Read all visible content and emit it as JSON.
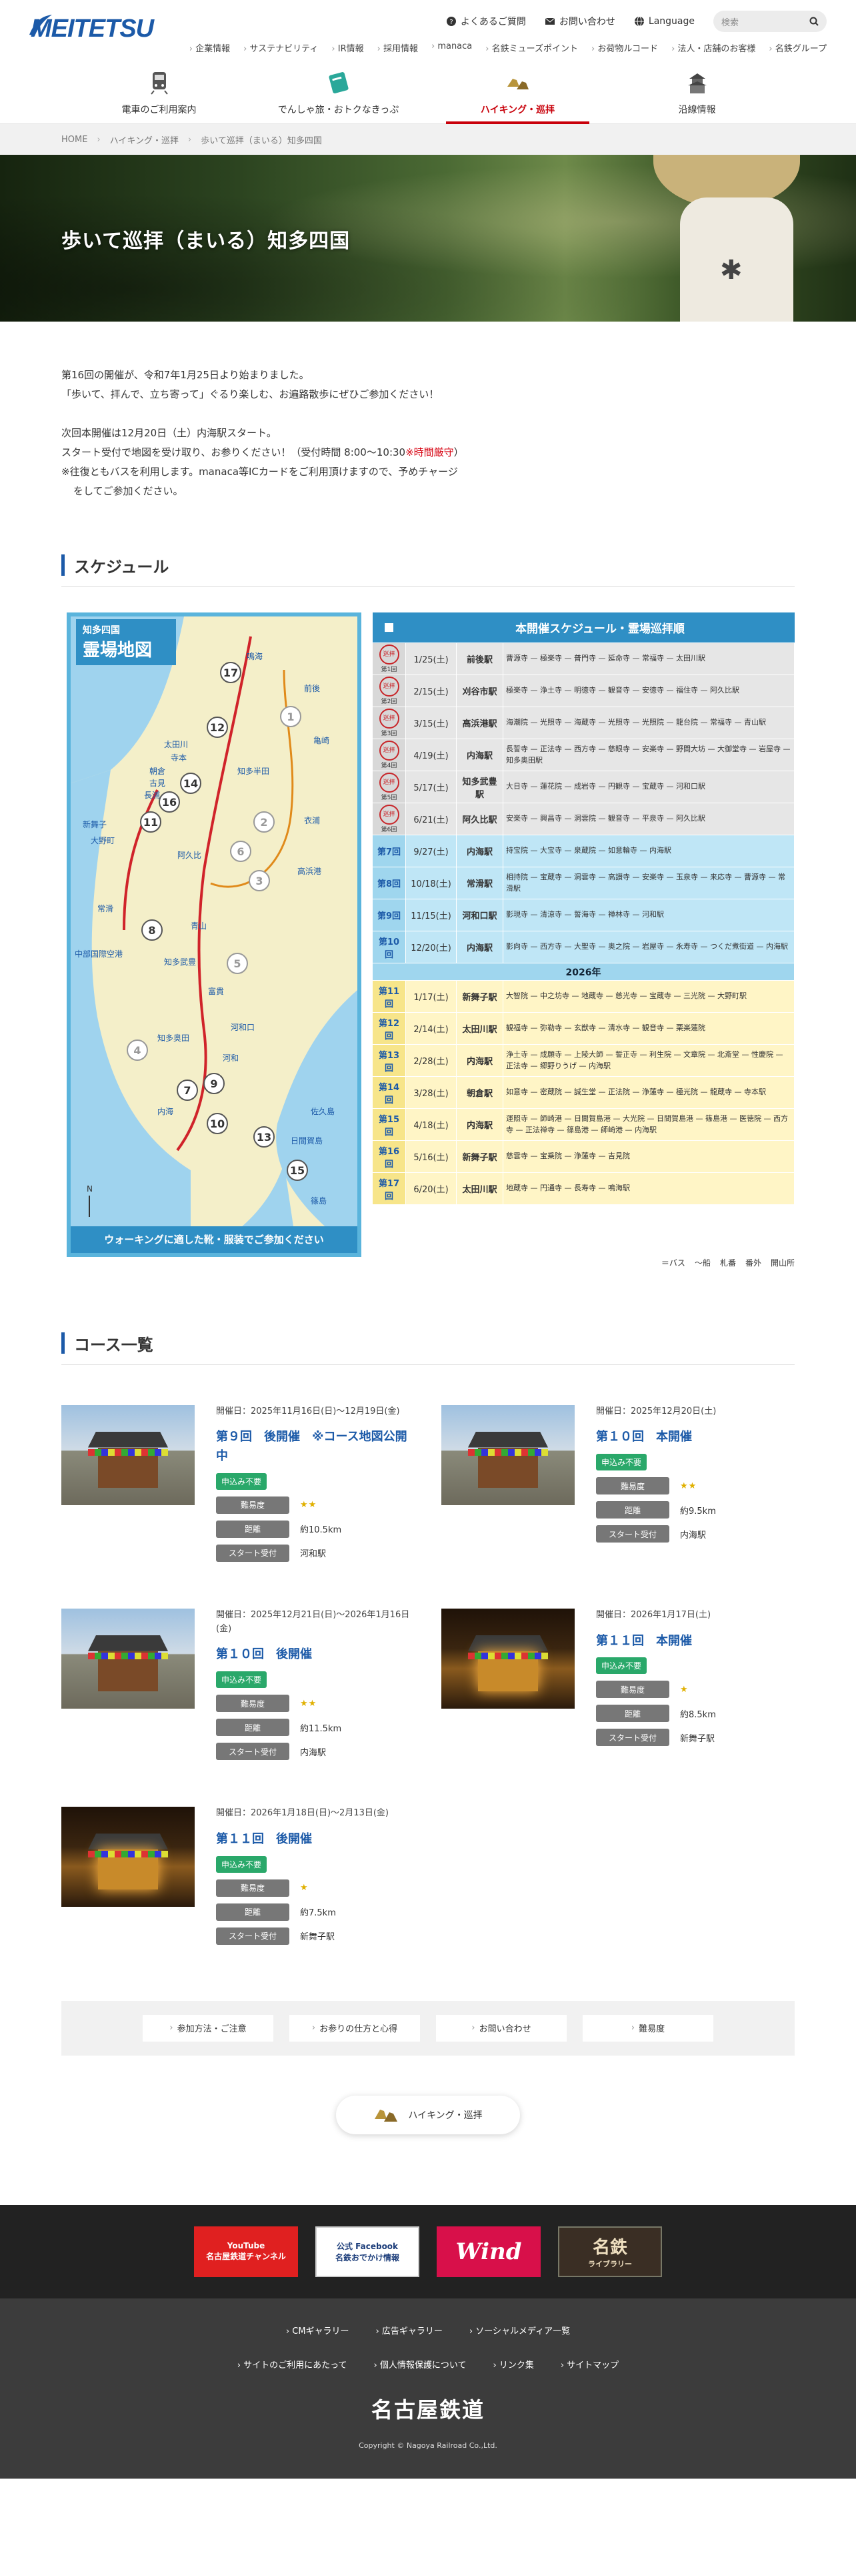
{
  "header": {
    "logo": "MEITETSU",
    "util": [
      {
        "icon": "help-circle-icon",
        "label": "よくあるご質問"
      },
      {
        "icon": "mail-icon",
        "label": "お問い合わせ"
      },
      {
        "icon": "globe-icon",
        "label": "Language"
      }
    ],
    "search_placeholder": "検索",
    "sub_links": [
      "企業情報",
      "サステナビリティ",
      "IR情報",
      "採用情報",
      "manaca",
      "名鉄ミューズポイント",
      "お荷物ルコード",
      "法人・店舗のお客様",
      "名鉄グループ"
    ],
    "nav": [
      {
        "icon": "train-icon",
        "label": "電車のご利用案内"
      },
      {
        "icon": "ticket-icon",
        "label": "でんしゃ旅・おトクなきっぷ"
      },
      {
        "icon": "hiking-shoes-icon",
        "label": "ハイキング・巡拝"
      },
      {
        "icon": "castle-icon",
        "label": "沿線情報"
      }
    ]
  },
  "breadcrumb": [
    "HOME",
    "ハイキング・巡拝",
    "歩いて巡拝（まいる）知多四国"
  ],
  "hero": {
    "title": "歩いて巡拝（まいる）知多四国"
  },
  "intro": {
    "p1": "第16回の開催が、令和7年1月25日より始まりました。",
    "p2": "「歩いて、拝んで、立ち寄って」ぐるり楽しむ、お遍路散歩にぜひご参加ください！",
    "p3": "次回本開催は12月20日（土）内海駅スタート。",
    "p4a": "スタート受付で地図を受け取り、お参りください！（受付時間 8:00～10:30",
    "p4b": "※時間厳守",
    "p4c": "）",
    "p5": "※往復ともバスを利用します。manaca等ICカードをご利用頂けますので、予めチャージ",
    "p6": "をしてご参加ください。"
  },
  "schedule_heading": "スケジュール",
  "map": {
    "title_small": "知多四国",
    "title_large": "霊場地図",
    "note": "ウォーキングに適した靴・服装でご参加ください",
    "stations": [
      "太田川",
      "寺本",
      "朝倉",
      "古見",
      "長浦",
      "新舞子",
      "大野町",
      "常滑",
      "河和口",
      "河和",
      "知多半田",
      "知多武豊",
      "阿久比",
      "青山",
      "内海",
      "富貴",
      "知多奥田",
      "高浜港",
      "衣浦",
      "日間賀島",
      "篠島",
      "佐久島",
      "亀崎",
      "前後",
      "鳴海",
      "中部国際空港"
    ]
  },
  "table": {
    "head_col1": "■",
    "head_col2": "本開催スケジュール・霊場巡拝順",
    "rows": [
      {
        "idx": "第1回",
        "date": "1/25(土)",
        "station": "前後駅",
        "route": "曹源寺 — 極楽寺 — 普門寺 — 延命寺 — 常福寺 — 太田川駅",
        "type": "base"
      },
      {
        "idx": "第2回",
        "date": "2/15(土)",
        "station": "刈谷市駅",
        "route": "極楽寺 — 浄土寺 — 明徳寺 — 観音寺 — 安徳寺 — 福住寺 — 阿久比駅",
        "type": "base"
      },
      {
        "idx": "第3回",
        "date": "3/15(土)",
        "station": "高浜港駅",
        "route": "海潮院 — 光照寺 — 海蔵寺 — 光照寺 — 光照院 — 龍台院 — 常福寺 — 青山駅",
        "type": "base"
      },
      {
        "idx": "第4回",
        "date": "4/19(土)",
        "station": "内海駅",
        "route": "長誓寺 — 正法寺 — 西方寺 — 慈眼寺 — 安楽寺 — 野間大坊 — 大御堂寺 — 岩屋寺 — 知多奥田駅",
        "type": "base"
      },
      {
        "idx": "第5回",
        "date": "5/17(土)",
        "station": "知多武豊駅",
        "route": "大日寺 — 蓮花院 — 成岩寺 — 円観寺 — 宝蔵寺 — 河和口駅",
        "type": "base"
      },
      {
        "idx": "第6回",
        "date": "6/21(土)",
        "station": "阿久比駅",
        "route": "安楽寺 — 興昌寺 — 洞雲院 — 観音寺 — 平泉寺 — 阿久比駅",
        "type": "base"
      },
      {
        "idx": "第7回",
        "date": "9/27(土)",
        "station": "内海駅",
        "route": "持宝院 — 大宝寺 — 泉蔵院 — 如意輪寺 — 内海駅",
        "type": "special"
      },
      {
        "idx": "第8回",
        "date": "10/18(土)",
        "station": "常滑駅",
        "route": "相持院 — 宝蔵寺 — 洞雲寺 — 高讃寺 — 安楽寺 — 玉泉寺 — 来応寺 — 曹源寺 — 常滑駅",
        "type": "special"
      },
      {
        "idx": "第9回",
        "date": "11/15(土)",
        "station": "河和口駅",
        "route": "影現寺 — 清涼寺 — 誓海寺 — 禅林寺 — 河和駅",
        "type": "special"
      },
      {
        "idx": "第10回",
        "date": "12/20(土)",
        "station": "内海駅",
        "route": "影向寺 — 西方寺 — 大聖寺 — 奥之院 — 岩屋寺 — 永寿寺 — つくだ煮街道 — 内海駅",
        "type": "special"
      }
    ],
    "year2026": "2026年",
    "rows2026": [
      {
        "idx": "第11回",
        "date": "1/17(土)",
        "station": "新舞子駅",
        "route": "大智院 — 中之坊寺 — 地蔵寺 — 慈光寺 — 宝蔵寺 — 三光院 — 大野町駅"
      },
      {
        "idx": "第12回",
        "date": "2/14(土)",
        "station": "太田川駅",
        "route": "観福寺 — 弥勒寺 — 玄猷寺 — 清水寺 — 観音寺 — 栗楽蓮院"
      },
      {
        "idx": "第13回",
        "date": "2/28(土)",
        "station": "内海駅",
        "route": "浄土寺 — 成願寺 — 上陵大師 — 誓正寺 — 利生院 — 文章院 — 北斎堂 — 性慶院 — 正法寺 — 郷野りうげ — 内海駅"
      },
      {
        "idx": "第14回",
        "date": "3/28(土)",
        "station": "朝倉駅",
        "route": "如意寺 — 密蔵院 — 誠生堂 — 正法院 — 浄蓮寺 — 極光院 — 龍蔵寺 — 寺本駅"
      },
      {
        "idx": "第15回",
        "date": "4/18(土)",
        "station": "内海駅",
        "route": "運照寺 — 師崎港 — 日間賀島港 — 大光院 — 日間賀島港 — 篠島港 — 医徳院 — 西方寺 — 正法禅寺 — 篠島港 — 師崎港 — 内海駅"
      },
      {
        "idx": "第16回",
        "date": "5/16(土)",
        "station": "新舞子駅",
        "route": "慈雲寺 — 宝乗院 — 浄蓮寺 — 吉見院"
      },
      {
        "idx": "第17回",
        "date": "6/20(土)",
        "station": "太田川駅",
        "route": "地蔵寺 — 円通寺 — 長寿寺 — 鳴海駅"
      }
    ],
    "seal_text": "巡拝",
    "legend": [
      "＝バス",
      "〜船",
      "札番",
      "番外",
      "開山所"
    ]
  },
  "course_heading": "コース一覧",
  "courses": [
    {
      "when": "開催日：2025年11月16日(日)～12月19日(金)",
      "title": "第９回　後開催　※コース地図公開中",
      "apply": "申込み不要",
      "k1": "難易度",
      "v1": "★★",
      "k2": "距離",
      "v2": "約10.5km",
      "k3": "スタート受付",
      "v3": "河和駅",
      "img": "day"
    },
    {
      "when": "開催日：2025年12月20日(土)",
      "title": "第１０回　本開催",
      "apply": "申込み不要",
      "k1": "難易度",
      "v1": "★★",
      "k2": "距離",
      "v2": "約9.5km",
      "k3": "スタート受付",
      "v3": "内海駅",
      "img": "day"
    },
    {
      "when": "開催日：2025年12月21日(日)～2026年1月16日(金)",
      "title": "第１０回　後開催",
      "apply": "申込み不要",
      "k1": "難易度",
      "v1": "★★",
      "k2": "距離",
      "v2": "約11.5km",
      "k3": "スタート受付",
      "v3": "内海駅",
      "img": "day"
    },
    {
      "when": "開催日：2026年1月17日(土)",
      "title": "第１１回　本開催",
      "apply": "申込み不要",
      "k1": "難易度",
      "v1": "★",
      "k2": "距離",
      "v2": "約8.5km",
      "k3": "スタート受付",
      "v3": "新舞子駅",
      "img": "night"
    },
    {
      "when": "開催日：2026年1月18日(日)～2月13日(金)",
      "title": "第１１回　後開催",
      "apply": "申込み不要",
      "k1": "難易度",
      "v1": "★",
      "k2": "距離",
      "v2": "約7.5km",
      "k3": "スタート受付",
      "v3": "新舞子駅",
      "img": "night"
    }
  ],
  "linkbar": [
    "参加方法・ご注意",
    "お参りの仕方と心得",
    "お問い合わせ",
    "難易度"
  ],
  "back_pill": "ハイキング・巡拝",
  "footer": {
    "banners": [
      {
        "icon": "youtube-icon",
        "line1": "YouTube",
        "line2": "名古屋鉄道チャンネル"
      },
      {
        "icon": "facebook-icon",
        "line1": "公式 Facebook",
        "line2": "名鉄おでかけ情報"
      },
      {
        "icon": "wind-logo-icon",
        "line1": "Wind",
        "line2": ""
      },
      {
        "icon": "meisho-logo-icon",
        "line1": "名鉄",
        "line2": "ライブラリー"
      }
    ],
    "links_row1": [
      "CMギャラリー",
      "広告ギャラリー",
      "ソーシャルメディア一覧"
    ],
    "links_row2": [
      "サイトのご利用にあたって",
      "個人情報保護について",
      "リンク集",
      "サイトマップ"
    ],
    "company": "名古屋鉄道",
    "copyright": "Copyright © Nagoya Railroad Co.,Ltd."
  },
  "colors": {
    "brand": "#1c5aa8",
    "accent_red": "#c8000a",
    "map_blue": "#2f8fc5",
    "apply_green": "#2aa86a"
  }
}
